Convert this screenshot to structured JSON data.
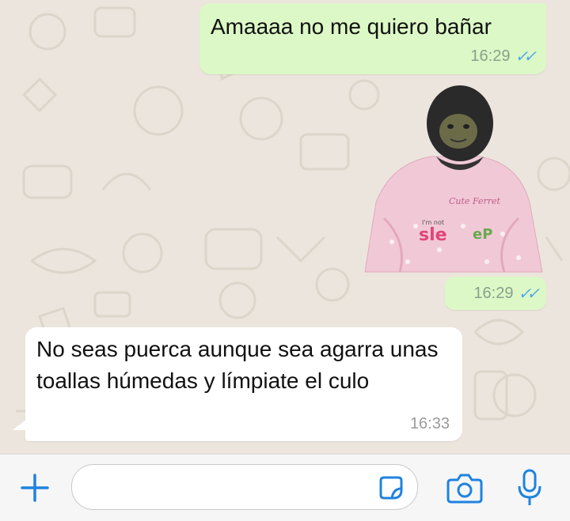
{
  "messages": [
    {
      "direction": "outgoing",
      "text": "Amaaaa no me quiero bañar",
      "time": "16:29",
      "status": "read"
    },
    {
      "direction": "outgoing",
      "type": "sticker",
      "time": "16:29",
      "status": "read",
      "sticker_text": [
        "Cute Ferret",
        "I'm not",
        "sle",
        "eP"
      ]
    },
    {
      "direction": "incoming",
      "text": "No seas puerca aunque sea agarra unas toallas húmedas y límpiate el culo",
      "time": "16:33"
    }
  ],
  "input": {
    "placeholder": "",
    "value": ""
  },
  "colors": {
    "outgoing_bubble": "#dcf8c6",
    "incoming_bubble": "#ffffff",
    "accent": "#1f83e0",
    "read_ticks": "#4fa8e6"
  },
  "icons": [
    "plus-icon",
    "sticker-icon",
    "camera-icon",
    "microphone-icon"
  ]
}
